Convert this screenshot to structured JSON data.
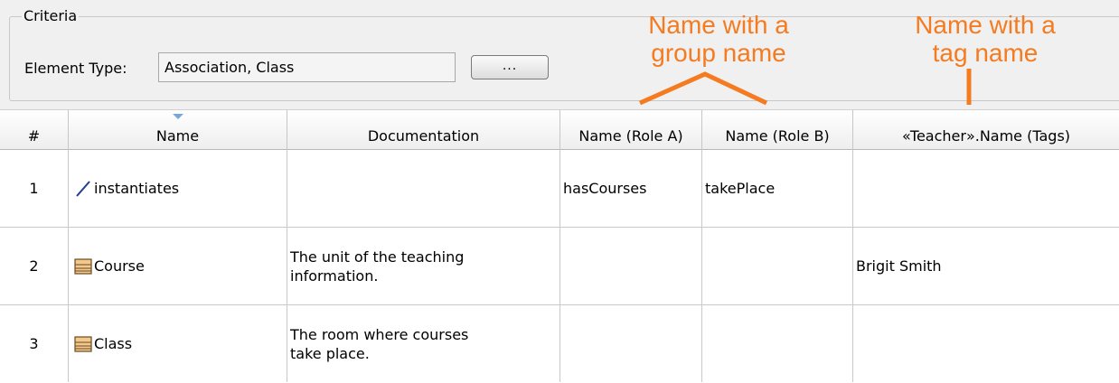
{
  "criteria": {
    "title": "Criteria",
    "element_type_label": "Element Type:",
    "element_type_value": "Association, Class",
    "browse_button_label": "..."
  },
  "annotations": {
    "group_name": [
      "Name with a",
      "group name"
    ],
    "tag_name": [
      "Name with a",
      "tag name"
    ],
    "color": "#f47b20"
  },
  "table": {
    "columns": [
      "#",
      "Name",
      "Documentation",
      "Name (Role A)",
      "Name (Role B)",
      "«Teacher».Name (Tags)"
    ],
    "sorted_column": "Name",
    "rows": [
      {
        "num": "1",
        "icon": "association-icon",
        "name": "instantiates",
        "doc": [
          "",
          ""
        ],
        "role_a": "hasCourses",
        "role_b": "takePlace",
        "tags": ""
      },
      {
        "num": "2",
        "icon": "class-icon",
        "name": "Course",
        "doc": [
          "The unit of the teaching",
          "information."
        ],
        "role_a": "",
        "role_b": "",
        "tags": "Brigit Smith"
      },
      {
        "num": "3",
        "icon": "class-icon",
        "name": "Class",
        "doc": [
          "The room  where courses",
          "take place."
        ],
        "role_a": "",
        "role_b": "",
        "tags": ""
      }
    ]
  }
}
